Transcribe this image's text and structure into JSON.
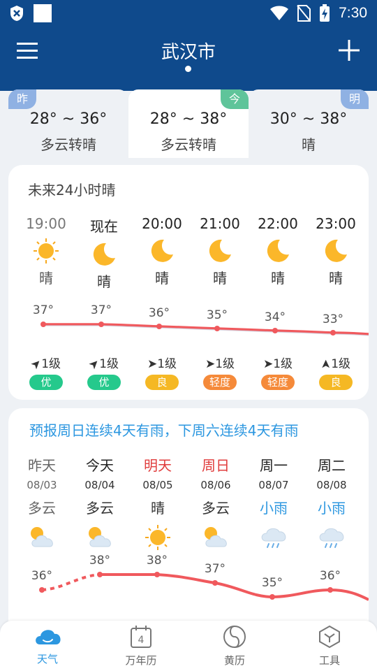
{
  "status_bar": {
    "time": "7:30",
    "icons": [
      "shield-icon",
      "blank-square-icon",
      "wifi-icon",
      "no-sim-icon",
      "battery-charging-icon"
    ]
  },
  "header": {
    "city": "武汉市",
    "menu_icon": "hamburger-menu-icon",
    "add_icon": "plus-icon"
  },
  "day_tabs": [
    {
      "badge": "昨",
      "temp": "28° ~ 36°",
      "desc": "多云转晴"
    },
    {
      "badge": "今",
      "temp": "28° ~ 38°",
      "desc": "多云转晴"
    },
    {
      "badge": "明",
      "temp": "30° ~ 38°",
      "desc": "晴"
    }
  ],
  "hourly": {
    "title": "未来24小时晴",
    "items": [
      {
        "time": "19:00",
        "weather": "晴",
        "temp": "37°",
        "wind": "1级",
        "aqi": "优",
        "icon": "sun-icon"
      },
      {
        "time": "现在",
        "weather": "晴",
        "temp": "37°",
        "wind": "1级",
        "aqi": "优",
        "icon": "moon-icon"
      },
      {
        "time": "20:00",
        "weather": "晴",
        "temp": "36°",
        "wind": "1级",
        "aqi": "良",
        "icon": "moon-icon"
      },
      {
        "time": "21:00",
        "weather": "晴",
        "temp": "35°",
        "wind": "1级",
        "aqi": "轻度",
        "icon": "moon-icon"
      },
      {
        "time": "22:00",
        "weather": "晴",
        "temp": "34°",
        "wind": "1级",
        "aqi": "轻度",
        "icon": "moon-icon"
      },
      {
        "time": "23:00",
        "weather": "晴",
        "temp": "33°",
        "wind": "1级",
        "aqi": "良",
        "icon": "moon-icon"
      }
    ],
    "aqi_colors": {
      "优": "#25c98c",
      "良": "#f5b824",
      "轻度": "#f58a3a"
    }
  },
  "forecast": {
    "title": "预报周日连续4天有雨，下周六连续4天有雨",
    "days": [
      {
        "name": "昨天",
        "date": "08/03",
        "weather": "多云",
        "temp": "36°",
        "icon": "partly-cloudy-icon"
      },
      {
        "name": "今天",
        "date": "08/04",
        "weather": "多云",
        "temp": "38°",
        "icon": "partly-cloudy-icon"
      },
      {
        "name": "明天",
        "date": "08/05",
        "weather": "晴",
        "temp": "38°",
        "icon": "sun-icon"
      },
      {
        "name": "周日",
        "date": "08/06",
        "weather": "多云",
        "temp": "37°",
        "icon": "partly-cloudy-icon"
      },
      {
        "name": "周一",
        "date": "08/07",
        "weather": "小雨",
        "temp": "35°",
        "icon": "light-rain-icon"
      },
      {
        "name": "周二",
        "date": "08/08",
        "weather": "小雨",
        "temp": "36°",
        "icon": "light-rain-icon"
      }
    ]
  },
  "bottom_nav": [
    {
      "label": "天气",
      "icon": "cloud-icon",
      "active": true
    },
    {
      "label": "万年历",
      "icon": "calendar-icon",
      "badge": "4",
      "active": false
    },
    {
      "label": "黄历",
      "icon": "yinyang-icon",
      "active": false
    },
    {
      "label": "工具",
      "icon": "toolbox-icon",
      "active": false
    }
  ],
  "colors": {
    "header_bg": "#0f4a8c",
    "accent_blue": "#2c97e0",
    "temp_line": "#f0595d",
    "weekend_red": "#e03d3d"
  }
}
